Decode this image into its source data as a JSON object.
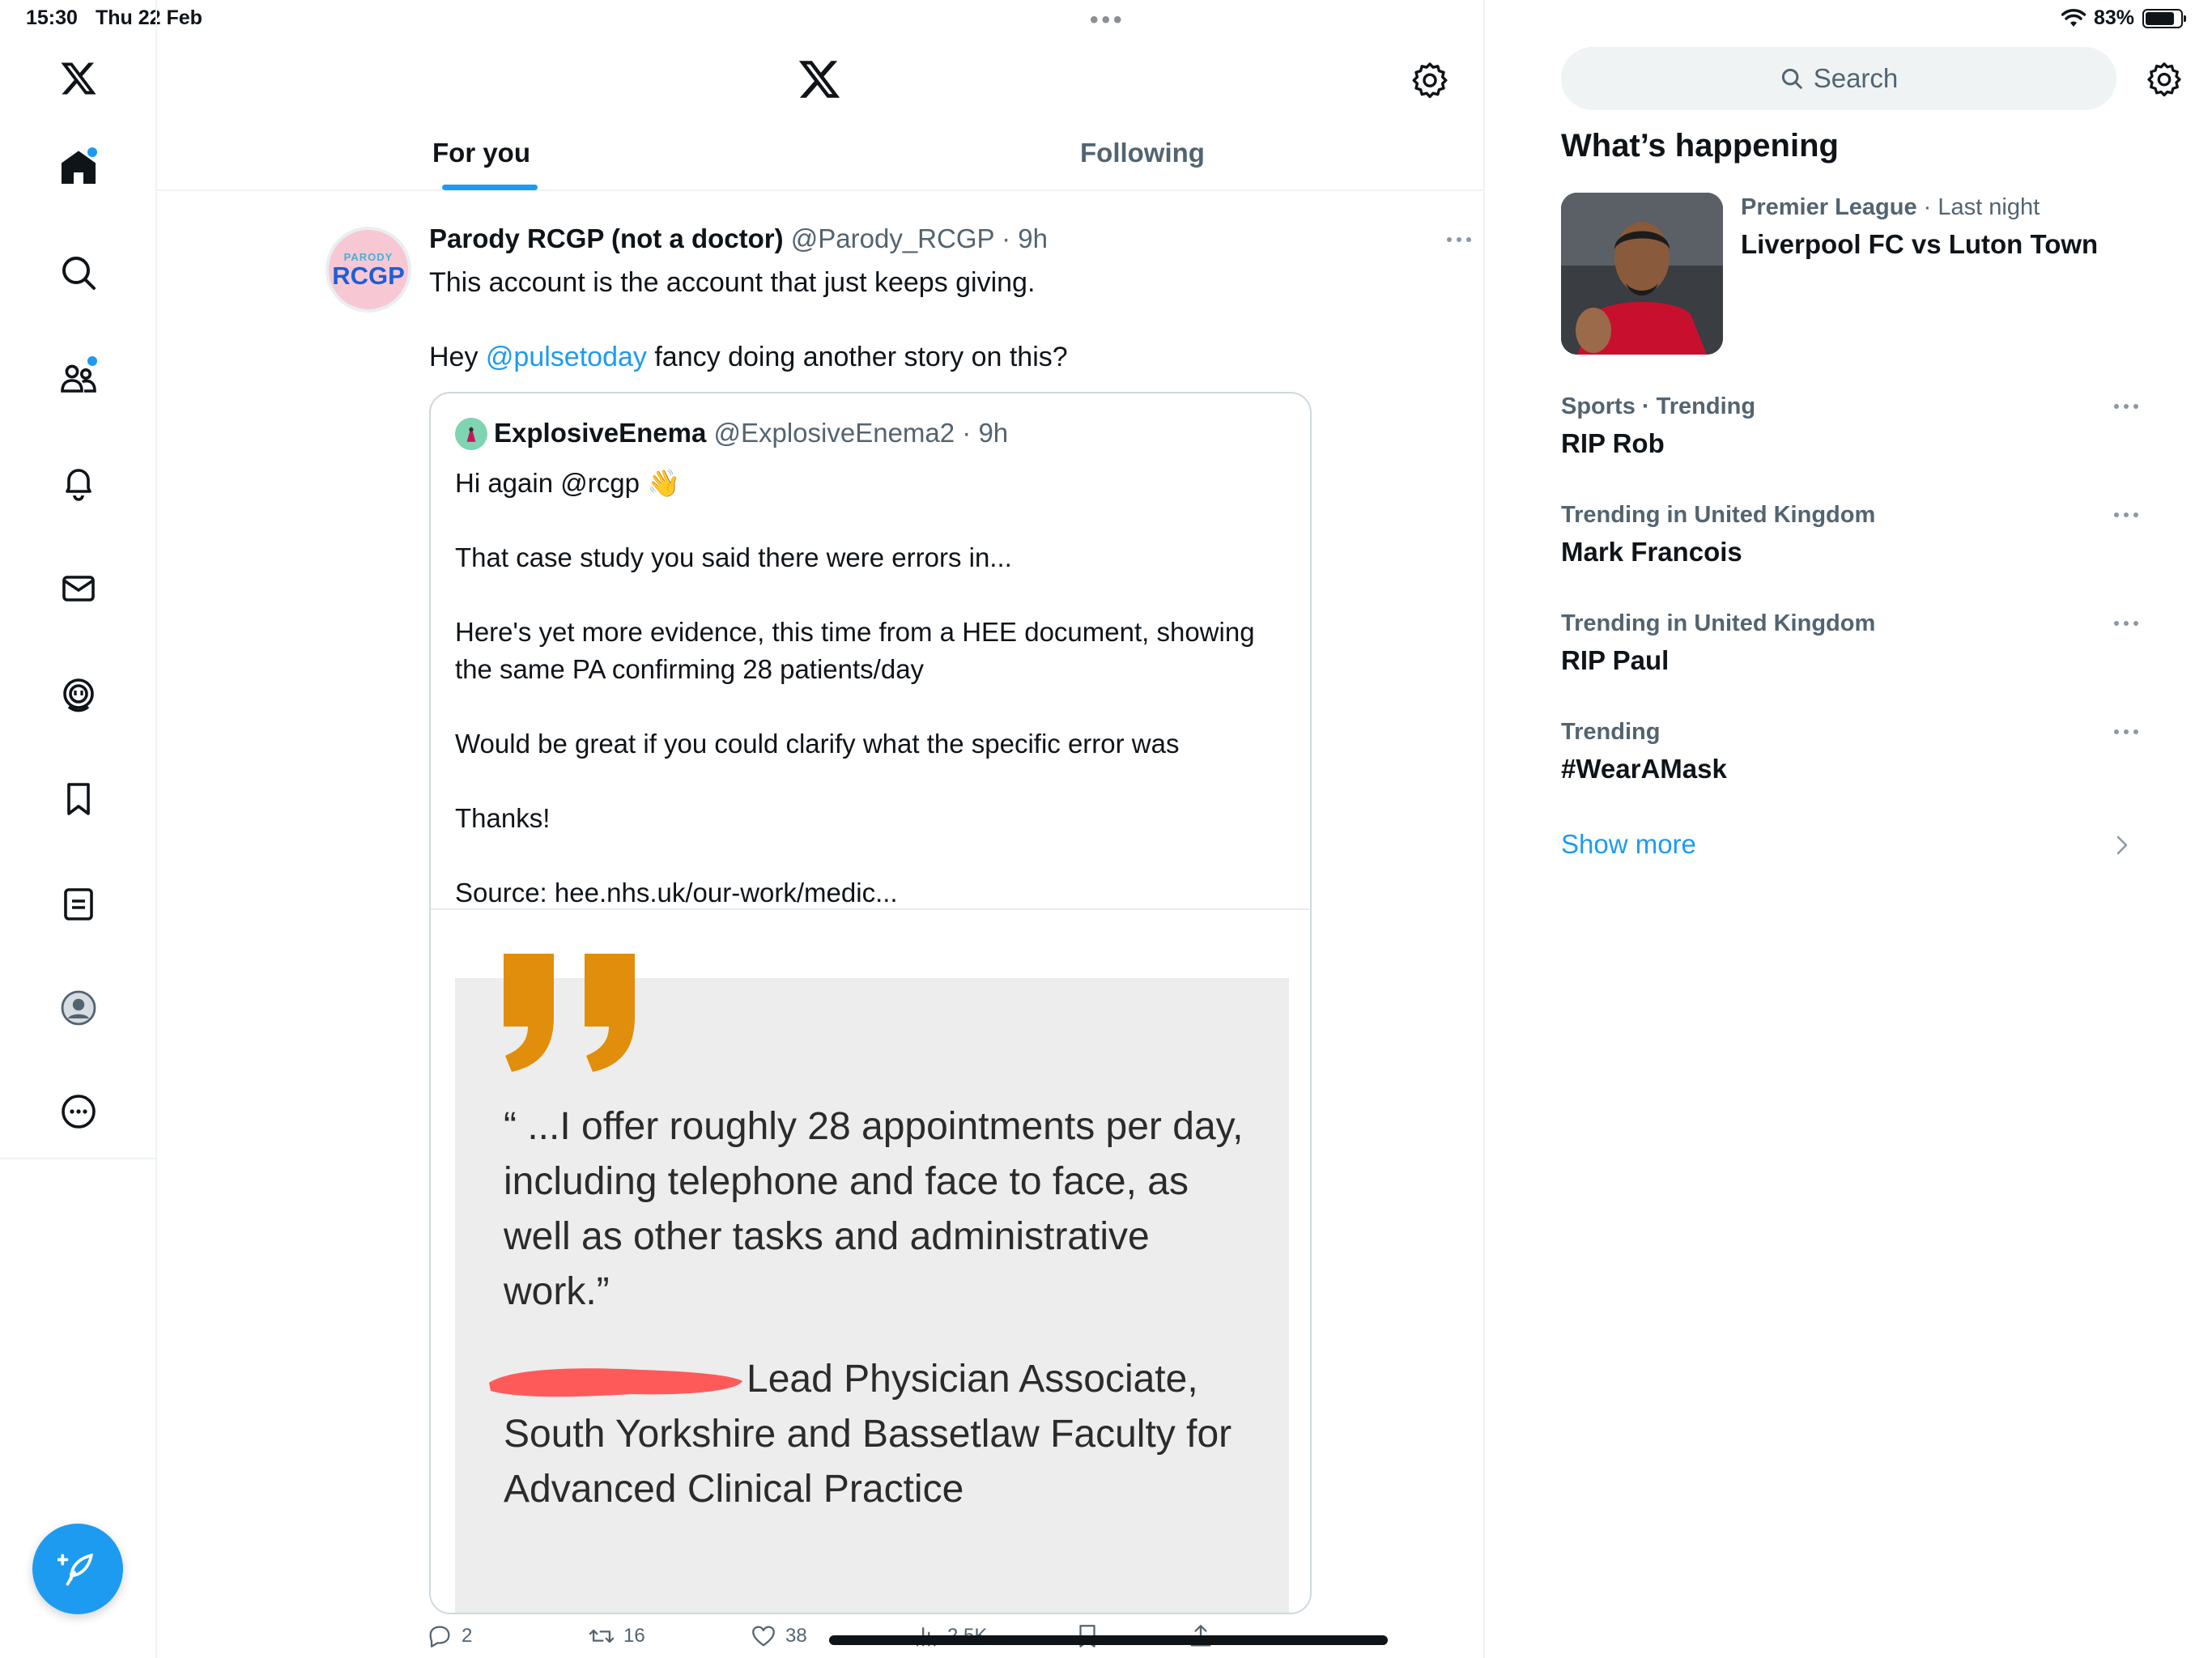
{
  "status_bar": {
    "time": "15:30",
    "date": "Thu 22 Feb",
    "battery": "83%",
    "battery_level": 0.83
  },
  "nav": {
    "items": [
      "x-logo",
      "home",
      "explore",
      "communities",
      "notifications",
      "messages",
      "grok",
      "bookmarks",
      "lists",
      "profile",
      "more"
    ]
  },
  "header": {
    "tabs": [
      "For you",
      "Following"
    ],
    "active_tab": "For you"
  },
  "tweet": {
    "avatar": {
      "small": "PARODY",
      "big": "RCGP"
    },
    "name": "Parody RCGP (not a doctor)",
    "handle": "@Parody_RCGP",
    "time": "9h",
    "line1": "This account is the account that just keeps giving.",
    "line2_before": "Hey ",
    "mention": "@pulsetoday",
    "line2_after": " fancy doing another story on this?",
    "quote": {
      "name": "ExplosiveEnema",
      "handle": "@ExplosiveEnema2",
      "time": "9h",
      "p1": "Hi again @rcgp 👋",
      "p2": "That case study you said there were errors in...",
      "p3": "Here's yet more evidence, this time from a HEE document, showing the same PA confirming 28 patients/day",
      "p4": "Would be great if you could clarify what the specific error was",
      "p5": "Thanks!",
      "p6": "Source: hee.nhs.uk/our-work/medic...",
      "image_quote": "“ ...I offer roughly 28 appointments per day, including telephone and face to face, as well as other tasks and administrative work.”",
      "image_attribution": "Lead Physician Associate, South Yorkshire and Bassetlaw Faculty for Advanced Clinical Practice"
    },
    "actions": {
      "replies": "2",
      "reposts": "16",
      "likes": "38",
      "views": "2.5K"
    }
  },
  "right": {
    "search_placeholder": "Search",
    "section_title": "What’s happening",
    "news": {
      "category": "Premier League",
      "when": "Last night",
      "title": "Liverpool FC vs Luton Town"
    },
    "trends": [
      {
        "meta": "Sports · Trending",
        "title": "RIP Rob"
      },
      {
        "meta": "Trending in United Kingdom",
        "title": "Mark Francois"
      },
      {
        "meta": "Trending in United Kingdom",
        "title": "RIP Paul"
      },
      {
        "meta": "Trending",
        "title": "#WearAMask"
      }
    ],
    "show_more": "Show more"
  },
  "colors": {
    "accent": "#1d9bf0",
    "text": "#0f1419",
    "muted": "#536471",
    "quote_mark": "#e08e0b",
    "redaction": "#ff5a5a"
  }
}
